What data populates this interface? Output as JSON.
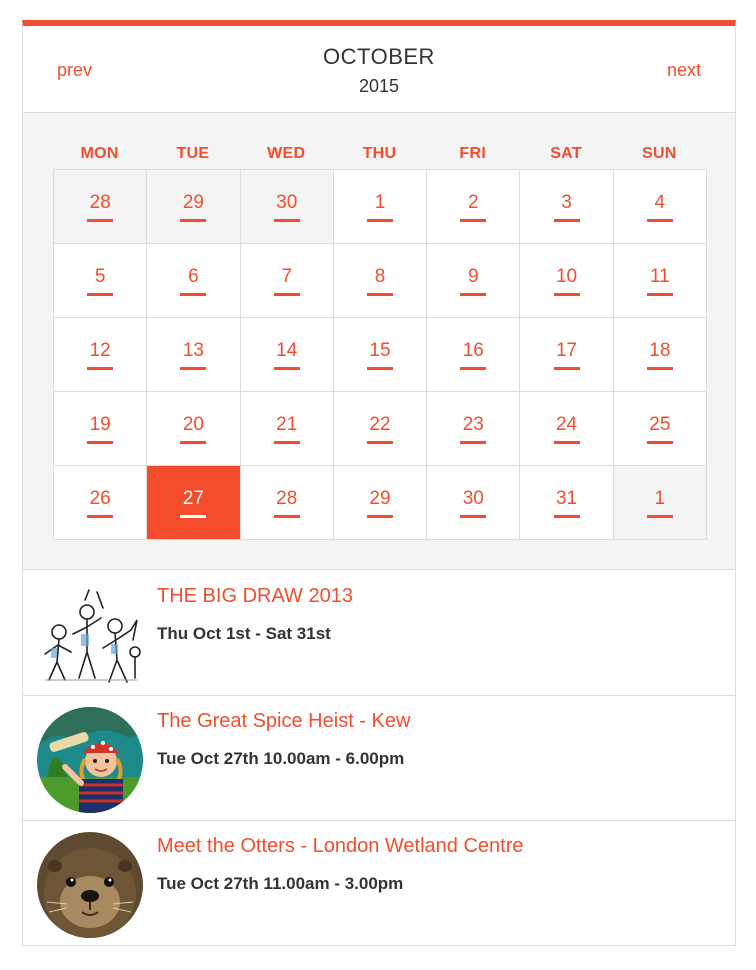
{
  "calendar": {
    "prev_label": "prev",
    "next_label": "next",
    "month": "OCTOBER",
    "year": "2015",
    "weekdays": [
      "MON",
      "TUE",
      "WED",
      "THU",
      "FRI",
      "SAT",
      "SUN"
    ],
    "weeks": [
      [
        {
          "day": "28",
          "other": true
        },
        {
          "day": "29",
          "other": true
        },
        {
          "day": "30",
          "other": true
        },
        {
          "day": "1"
        },
        {
          "day": "2"
        },
        {
          "day": "3"
        },
        {
          "day": "4"
        }
      ],
      [
        {
          "day": "5"
        },
        {
          "day": "6"
        },
        {
          "day": "7"
        },
        {
          "day": "8"
        },
        {
          "day": "9"
        },
        {
          "day": "10"
        },
        {
          "day": "11"
        }
      ],
      [
        {
          "day": "12"
        },
        {
          "day": "13"
        },
        {
          "day": "14"
        },
        {
          "day": "15"
        },
        {
          "day": "16"
        },
        {
          "day": "17"
        },
        {
          "day": "18"
        }
      ],
      [
        {
          "day": "19"
        },
        {
          "day": "20"
        },
        {
          "day": "21"
        },
        {
          "day": "22"
        },
        {
          "day": "23"
        },
        {
          "day": "24"
        },
        {
          "day": "25"
        }
      ],
      [
        {
          "day": "26"
        },
        {
          "day": "27",
          "selected": true
        },
        {
          "day": "28"
        },
        {
          "day": "29"
        },
        {
          "day": "30"
        },
        {
          "day": "31"
        },
        {
          "day": "1",
          "other": true
        }
      ]
    ]
  },
  "events": [
    {
      "title": "THE BIG DRAW 2013",
      "date": "Thu Oct 1st - Sat 31st",
      "thumb": "sketch-figures-image"
    },
    {
      "title": "The Great Spice Heist - Kew",
      "date": "Tue Oct 27th 10.00am - 6.00pm",
      "thumb": "pirate-girl-image"
    },
    {
      "title": "Meet the Otters - London Wetland Centre",
      "date": "Tue Oct 27th 11.00am - 3.00pm",
      "thumb": "otter-image"
    }
  ],
  "colors": {
    "accent": "#f44d2e",
    "border": "#dcdcdc",
    "panel_bg": "#f4f4f4",
    "text": "#333333"
  }
}
